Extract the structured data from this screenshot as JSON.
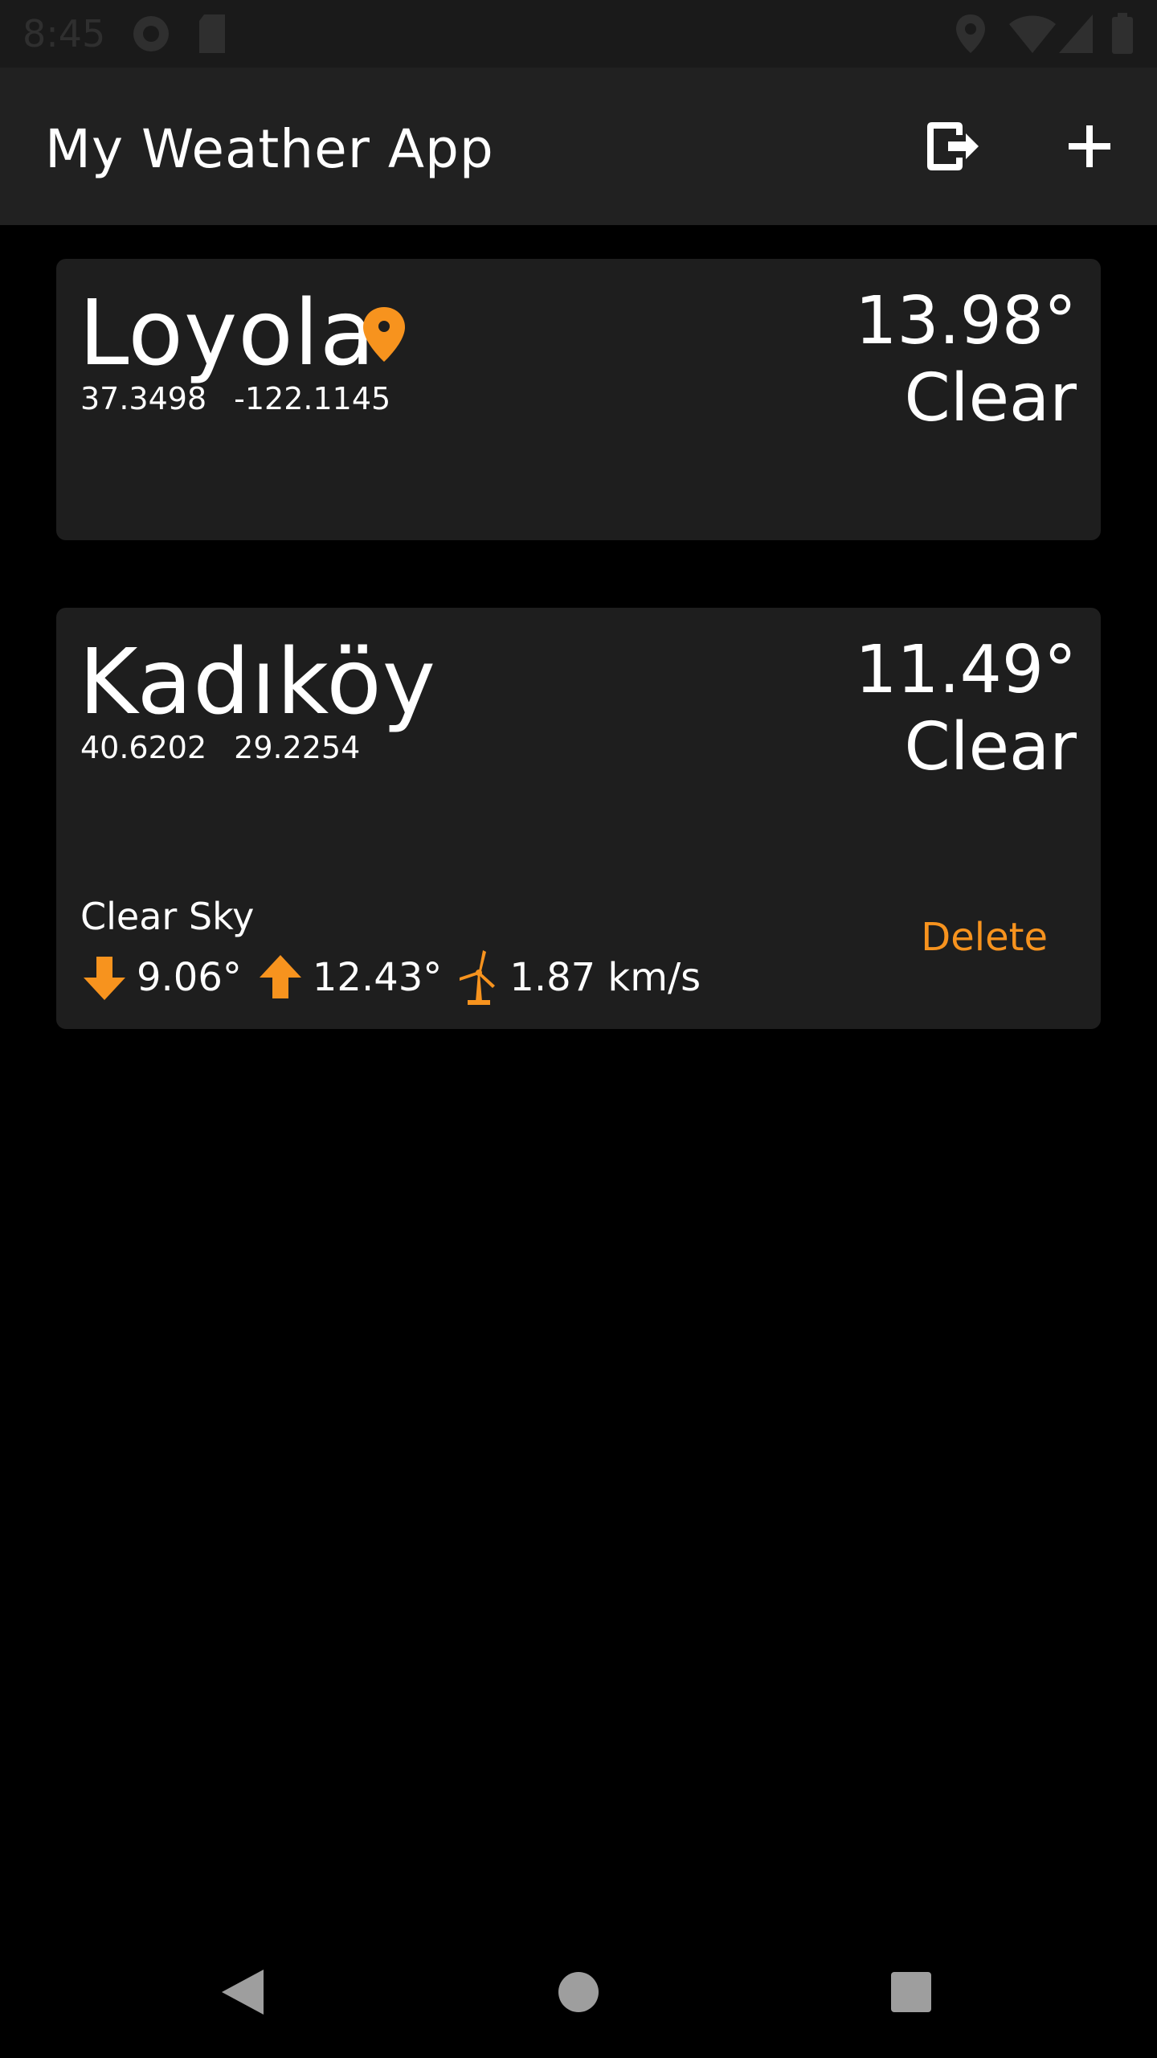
{
  "status_bar": {
    "time": "8:45",
    "icons": [
      "data-saver-icon",
      "sd-card-icon",
      "location-icon",
      "wifi-icon",
      "signal-icon",
      "battery-icon"
    ]
  },
  "app_bar": {
    "title": "My Weather App",
    "actions": [
      "logout-icon",
      "add-icon"
    ]
  },
  "colors": {
    "accent": "#f7931e",
    "card_bg": "#1e1e1e",
    "app_bar_bg": "#212121",
    "background": "#000000"
  },
  "locations": [
    {
      "city": "Loyola",
      "lat": "37.3498",
      "lon": "-122.1145",
      "temp": "13.98°",
      "condition": "Clear",
      "current_location": true
    },
    {
      "city": "Kadıköy",
      "lat": "40.6202",
      "lon": "29.2254",
      "temp": "11.49°",
      "condition": "Clear",
      "description": "Clear Sky",
      "temp_min": "9.06°",
      "temp_max": "12.43°",
      "wind": "1.87 km/s",
      "delete_label": "Delete"
    }
  ],
  "nav_bar": {
    "buttons": [
      "back-icon",
      "home-icon",
      "recents-icon"
    ]
  }
}
